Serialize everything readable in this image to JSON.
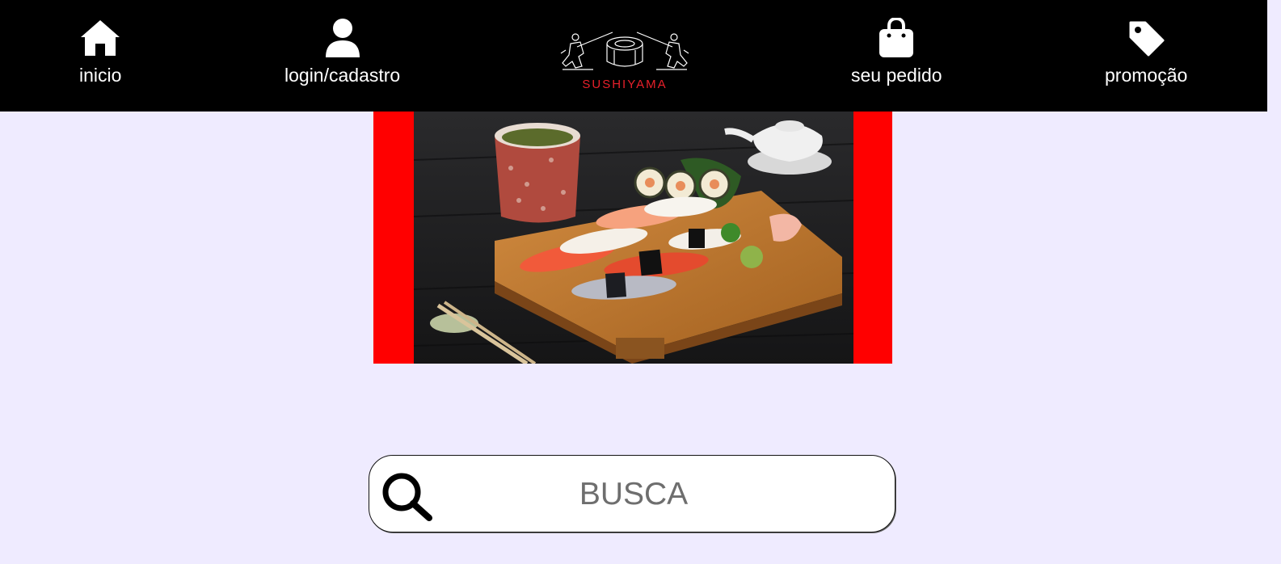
{
  "nav": {
    "items": [
      {
        "label": "inicio",
        "icon": "home-icon"
      },
      {
        "label": "login/cadastro",
        "icon": "user-icon"
      },
      {
        "label": "seu pedido",
        "icon": "shopping-bag-icon"
      },
      {
        "label": "promoção",
        "icon": "tag-icon"
      }
    ]
  },
  "logo": {
    "brand": "SUSHIYAMA",
    "brand_color": "#e8202a"
  },
  "colors": {
    "header_bg": "#000000",
    "page_bg": "#efebff",
    "hero_frame": "#ff0000"
  },
  "hero": {
    "image": "sushi-platter-photo"
  },
  "search": {
    "placeholder": "BUSCA",
    "value": ""
  }
}
